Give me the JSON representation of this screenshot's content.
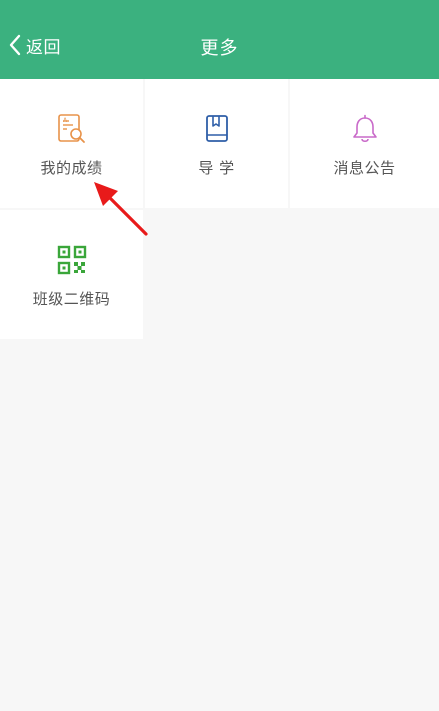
{
  "header": {
    "back_label": "返回",
    "title": "更多",
    "background": "#3bb17f"
  },
  "tiles": [
    {
      "label": "我的成绩",
      "icon": "score-search-icon",
      "color": "#e8934a"
    },
    {
      "label": "导 学",
      "icon": "book-icon",
      "color": "#2f5fa8"
    },
    {
      "label": "消息公告",
      "icon": "bell-icon",
      "color": "#c96ac9"
    },
    {
      "label": "班级二维码",
      "icon": "qr-code-icon",
      "color": "#3aa63a"
    }
  ],
  "annotation": {
    "icon": "red-arrow-icon",
    "color": "#e81a1a"
  }
}
